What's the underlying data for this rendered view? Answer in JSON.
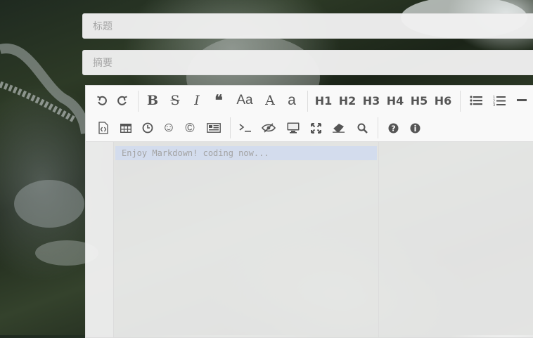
{
  "form": {
    "title_placeholder": "标题",
    "summary_placeholder": "摘要"
  },
  "toolbar": {
    "row1": [
      {
        "name": "undo-icon"
      },
      {
        "name": "redo-icon"
      },
      {
        "name": "bold-icon",
        "label": "B"
      },
      {
        "name": "strikethrough-icon",
        "label": "S"
      },
      {
        "name": "italic-icon",
        "label": "I"
      },
      {
        "name": "quote-icon",
        "label": "❝"
      },
      {
        "name": "uppercase-icon",
        "label": "Aa"
      },
      {
        "name": "first-uppercase-icon",
        "label": "A"
      },
      {
        "name": "lowercase-icon",
        "label": "a"
      },
      {
        "name": "h1",
        "label": "H1"
      },
      {
        "name": "h2",
        "label": "H2"
      },
      {
        "name": "h3",
        "label": "H3"
      },
      {
        "name": "h4",
        "label": "H4"
      },
      {
        "name": "h5",
        "label": "H5"
      },
      {
        "name": "h6",
        "label": "H6"
      },
      {
        "name": "unordered-list-icon"
      },
      {
        "name": "ordered-list-icon"
      },
      {
        "name": "horizontal-rule-icon"
      }
    ],
    "row2": [
      {
        "name": "code-block-icon"
      },
      {
        "name": "table-icon"
      },
      {
        "name": "datetime-icon"
      },
      {
        "name": "emoji-icon",
        "label": "☺"
      },
      {
        "name": "html-entities-icon",
        "label": "©"
      },
      {
        "name": "pagebreak-icon"
      },
      {
        "name": "terminal-icon"
      },
      {
        "name": "watch-toggle-icon"
      },
      {
        "name": "preview-icon"
      },
      {
        "name": "fullscreen-icon"
      },
      {
        "name": "clear-icon"
      },
      {
        "name": "search-icon"
      },
      {
        "name": "help-icon"
      },
      {
        "name": "info-icon"
      }
    ]
  },
  "editor": {
    "placeholder": "Enjoy Markdown! coding now..."
  }
}
